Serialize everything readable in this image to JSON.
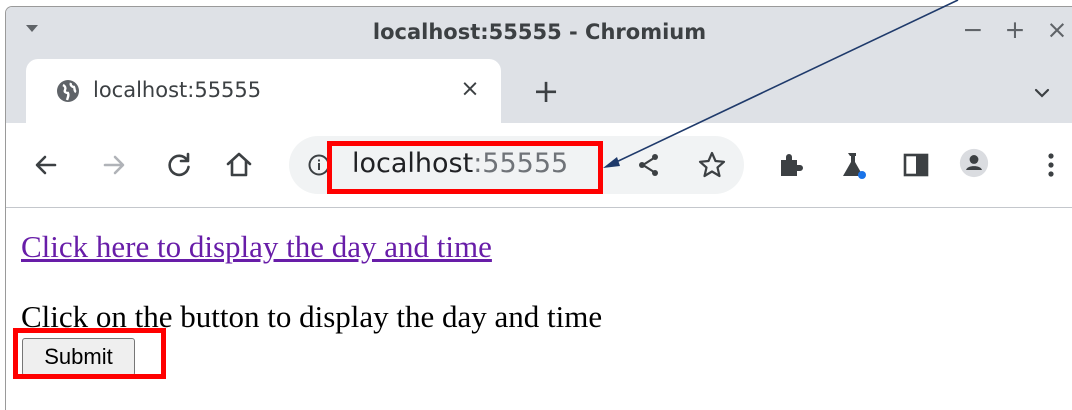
{
  "window": {
    "title": "localhost:55555 - Chromium",
    "controls": {
      "minimize": "−",
      "maximize": "+",
      "close": "×"
    }
  },
  "tab": {
    "title": "localhost:55555",
    "close_symbol": "×"
  },
  "new_tab_symbol": "+",
  "address_bar": {
    "host": "localhost",
    "port": ":55555"
  },
  "page": {
    "link_text": "Click here to display the day and time",
    "instruction": "Click on the button to display the day and time",
    "submit_label": "Submit"
  },
  "annotation": {
    "color": "#ff0000",
    "arrow_color": "#1f3a6b"
  }
}
